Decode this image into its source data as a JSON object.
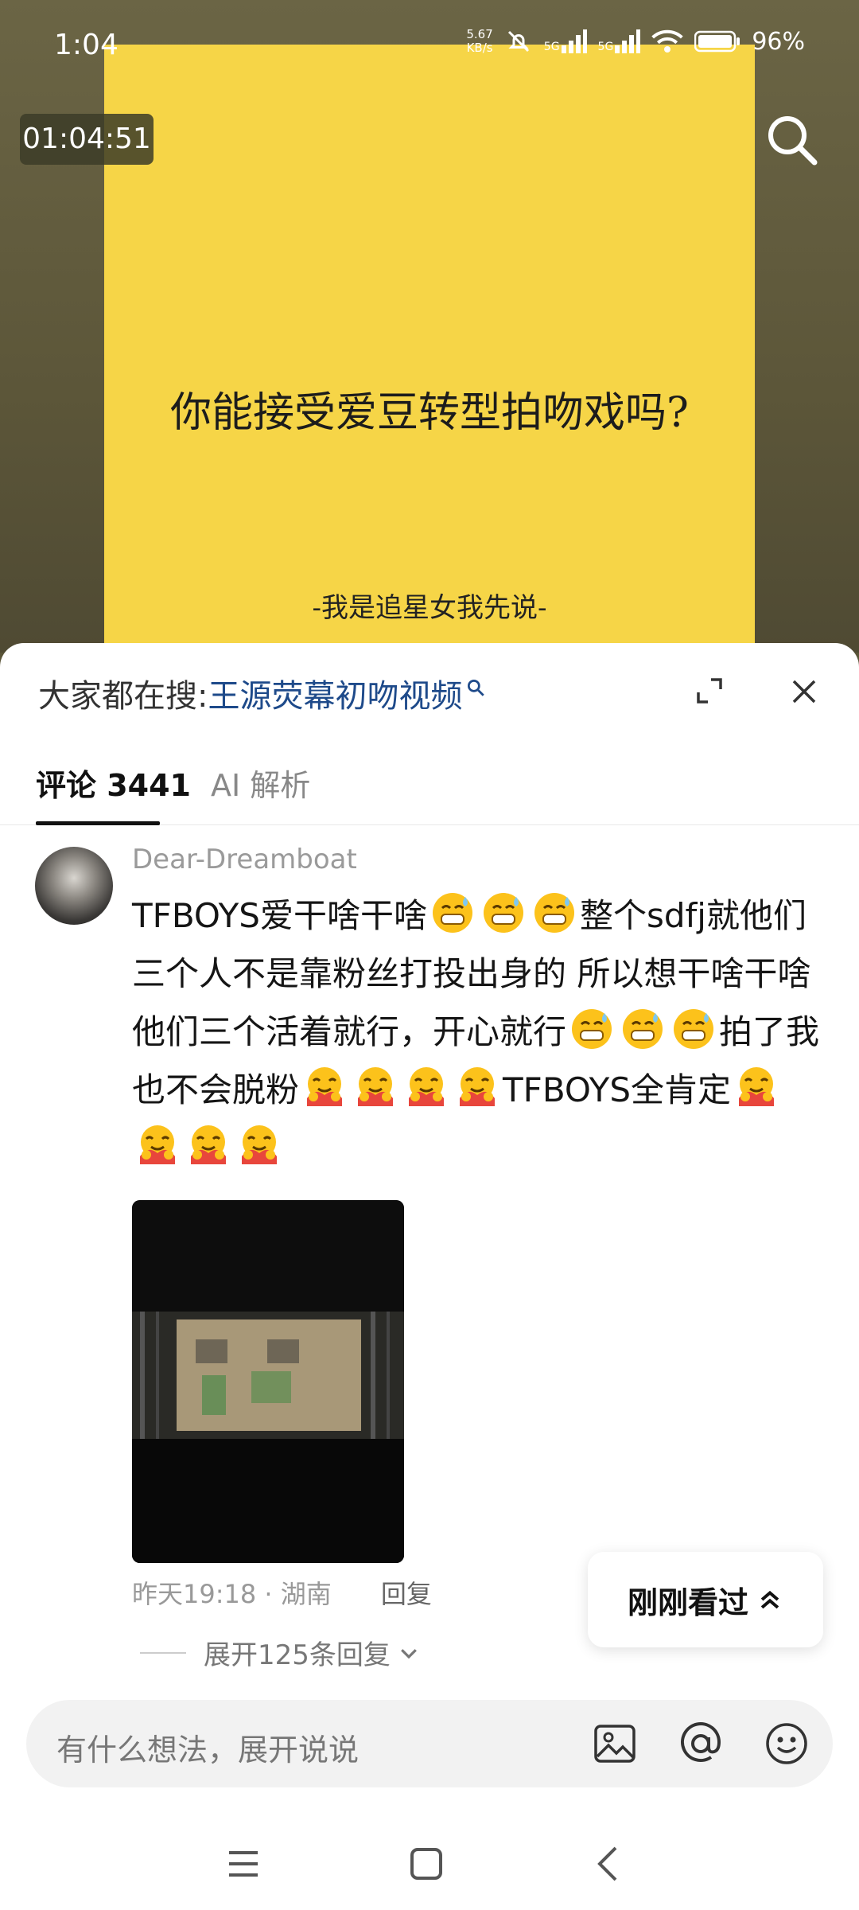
{
  "status_bar": {
    "time": "1:04",
    "net_speed": "5.67",
    "net_unit": "KB/s",
    "sim1": "5G",
    "sim2": "5G",
    "battery": "96%"
  },
  "video": {
    "timestamp": "01:04:51",
    "poster_question": "你能接受爱豆转型拍吻戏吗?",
    "poster_subtitle": "-我是追星女我先说-"
  },
  "sheet": {
    "hot_prefix": "大家都在搜:",
    "hot_keyword": "王源荧幕初吻视频",
    "tabs": [
      {
        "label": "评论 3441",
        "active": true
      },
      {
        "label": "AI 解析",
        "active": false
      }
    ]
  },
  "comment": {
    "username": "Dear-Dreamboat",
    "segments": [
      "TFBOYS爱干啥干啥",
      "整个sdfj就他们三个人不是靠粉丝打投出身的 所以想干啥干啥 他们三个活着就行，开心就行",
      "拍了我也不会脱粉",
      "TFBOYS全肯定"
    ],
    "meta_time": "昨天19:18 · 湖南",
    "reply_label": "回复",
    "expand_label": "展开125条回复"
  },
  "just_watched": {
    "label": "刚刚看过"
  },
  "input": {
    "placeholder": "有什么想法，展开说说"
  },
  "icons": {
    "emoji_sweat": "grinning-sweat-emoji",
    "emoji_hug": "hugging-emoji"
  },
  "colors": {
    "poster": "#f6d547",
    "keyword": "#1e4a8a"
  }
}
